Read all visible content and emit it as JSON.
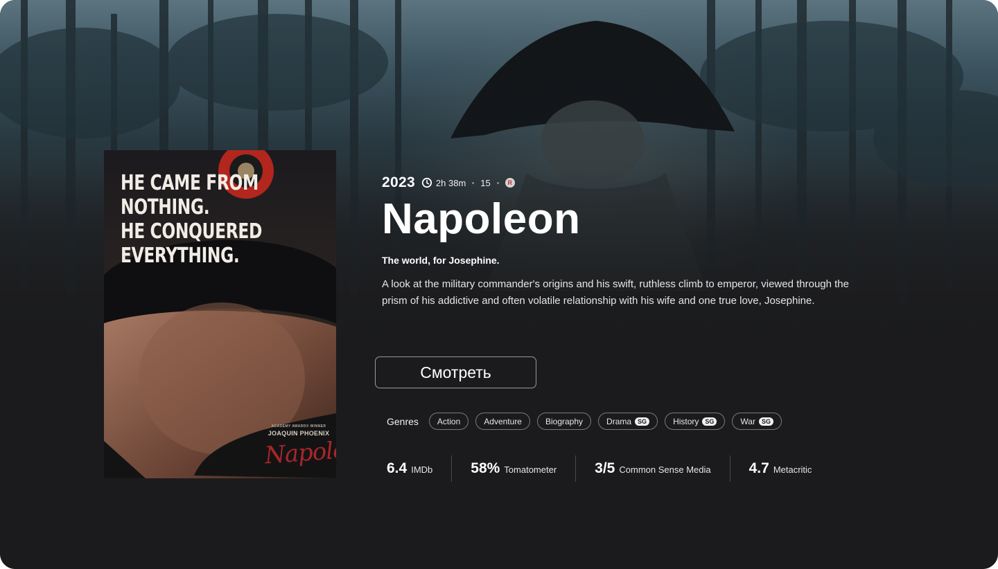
{
  "movie": {
    "year": "2023",
    "duration": "2h 38m",
    "age_rating": "15",
    "rated_badge": "R",
    "title": "Napoleon",
    "tagline": "The world, for Josephine.",
    "description": "A look at the military commander's origins and his swift, ruthless climb to emperor, viewed through the prism of his addictive and often volatile relationship with his wife and one true love, Josephine."
  },
  "poster": {
    "tagline_lines": [
      "HE CAME FROM",
      "NOTHING.",
      "HE CONQUERED",
      "EVERYTHING."
    ],
    "credit_small": "ACADEMY AWARD® WINNER",
    "credit_name": "JOAQUIN PHOENIX",
    "signature": "Napoleon"
  },
  "actions": {
    "watch_label": "Смотреть"
  },
  "genres": {
    "label": "Genres",
    "items": [
      {
        "name": "Action",
        "badge": ""
      },
      {
        "name": "Adventure",
        "badge": ""
      },
      {
        "name": "Biography",
        "badge": ""
      },
      {
        "name": "Drama",
        "badge": "SG"
      },
      {
        "name": "History",
        "badge": "SG"
      },
      {
        "name": "War",
        "badge": "SG"
      }
    ]
  },
  "ratings": [
    {
      "value": "6.4",
      "source": "IMDb"
    },
    {
      "value": "58%",
      "source": "Tomatometer"
    },
    {
      "value": "3/5",
      "source": "Common Sense Media"
    },
    {
      "value": "4.7",
      "source": "Metacritic"
    }
  ],
  "colors": {
    "background": "#1b1b1d",
    "poster_red": "#a8262b",
    "chip_border": "#7a7a7a"
  },
  "icons": {
    "duration": "clock-icon"
  }
}
